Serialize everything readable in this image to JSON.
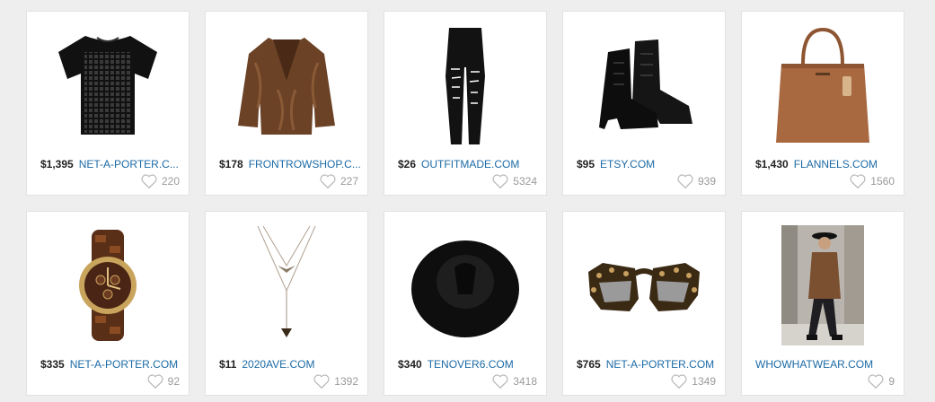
{
  "products": [
    {
      "price": "$1,395",
      "store": "NET-A-PORTER.C...",
      "likes": "220",
      "image": "black-tee-icon"
    },
    {
      "price": "$178",
      "store": "FRONTROWSHOP.C...",
      "likes": "227",
      "image": "fur-coat-icon"
    },
    {
      "price": "$26",
      "store": "OUTFITMADE.COM",
      "likes": "5324",
      "image": "ripped-jeans-icon"
    },
    {
      "price": "$95",
      "store": "ETSY.COM",
      "likes": "939",
      "image": "boots-icon"
    },
    {
      "price": "$1,430",
      "store": "FLANNELS.COM",
      "likes": "1560",
      "image": "tote-bag-icon"
    },
    {
      "price": "$335",
      "store": "NET-A-PORTER.COM",
      "likes": "92",
      "image": "watch-icon"
    },
    {
      "price": "$11",
      "store": "2020AVE.COM",
      "likes": "1392",
      "image": "necklace-icon"
    },
    {
      "price": "$340",
      "store": "TENOVER6.COM",
      "likes": "3418",
      "image": "hat-icon"
    },
    {
      "price": "$765",
      "store": "NET-A-PORTER.COM",
      "likes": "1349",
      "image": "sunglasses-icon"
    },
    {
      "price": "",
      "store": "WHOWHATWEAR.COM",
      "likes": "9",
      "image": "street-style-photo-icon"
    }
  ],
  "colors": {
    "link": "#1b6aa5",
    "price": "#222222",
    "count": "#9a9a9a",
    "card_border": "#e2e2e2",
    "page_bg": "#eeeeee"
  }
}
